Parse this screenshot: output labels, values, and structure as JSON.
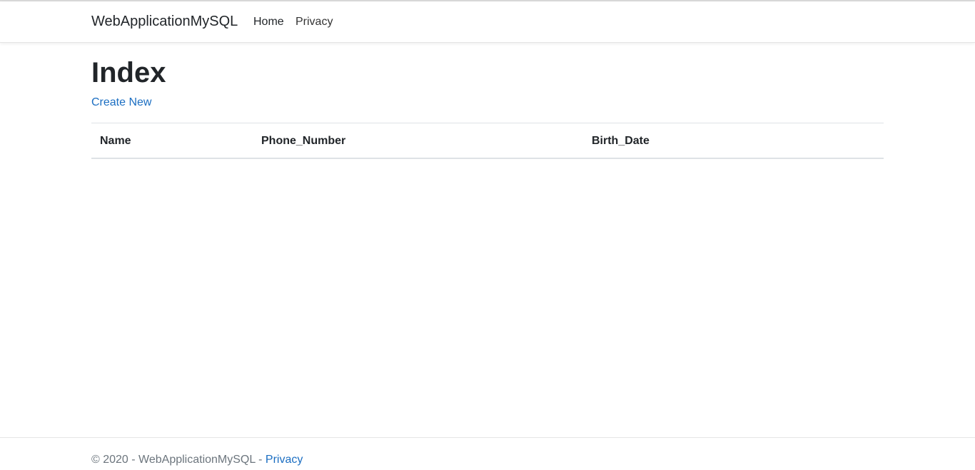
{
  "navbar": {
    "brand": "WebApplicationMySQL",
    "links": [
      {
        "label": "Home"
      },
      {
        "label": "Privacy"
      }
    ]
  },
  "main": {
    "title": "Index",
    "create_link": "Create New",
    "table": {
      "columns": [
        "Name",
        "Phone_Number",
        "Birth_Date"
      ],
      "rows": []
    }
  },
  "footer": {
    "copyright": "© 2020 - WebApplicationMySQL - ",
    "privacy_link": "Privacy"
  },
  "colors": {
    "link": "#1b6ec2",
    "text": "#212529",
    "muted": "#6c757d"
  }
}
